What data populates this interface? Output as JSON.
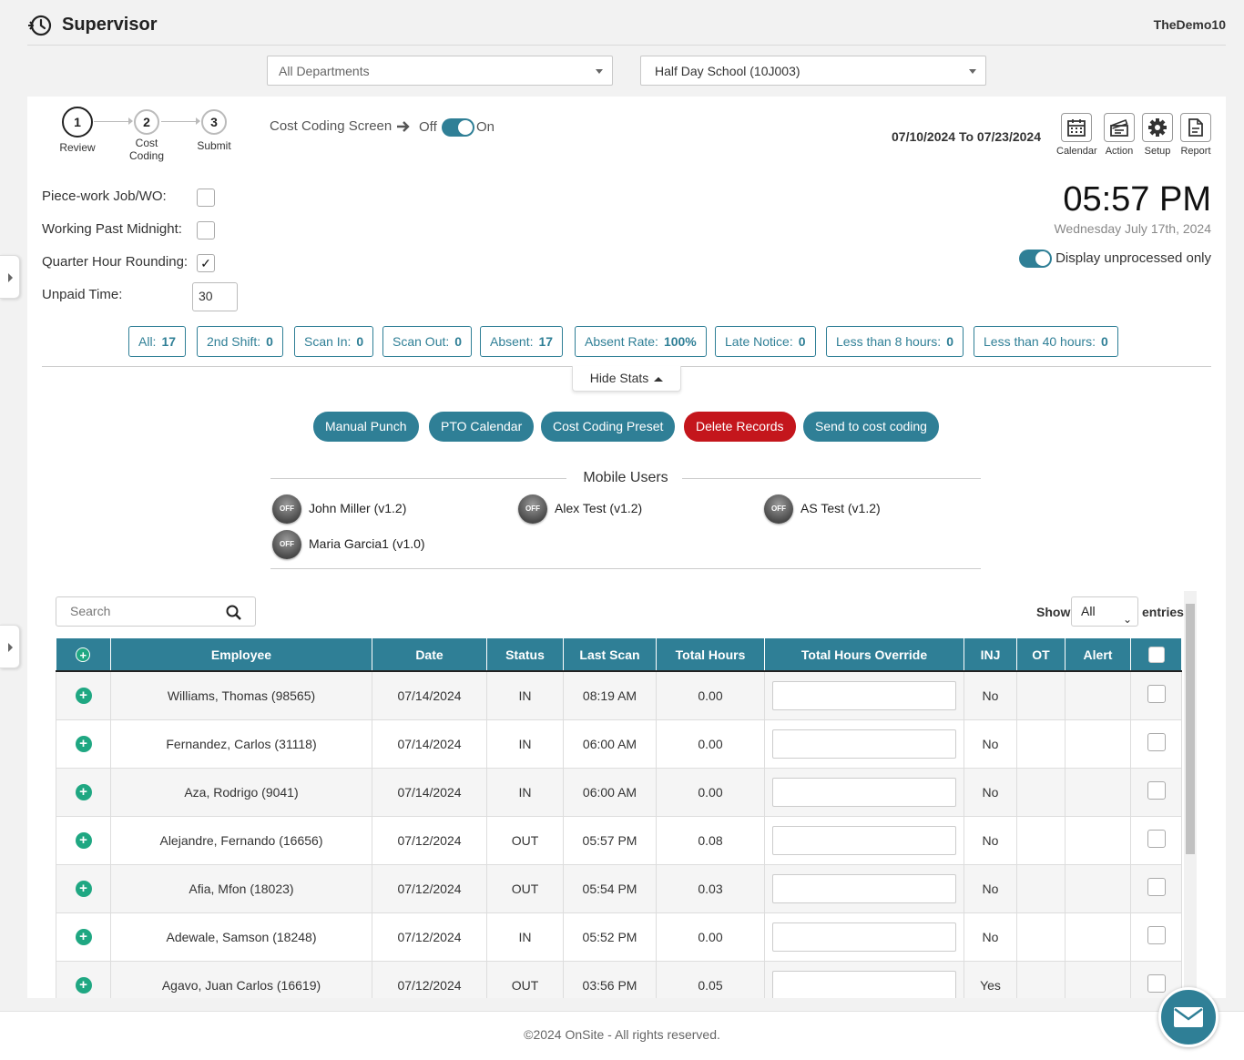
{
  "app": {
    "title": "Supervisor",
    "account": "TheDemo10"
  },
  "filters": {
    "department": "All Departments",
    "school": "Half Day School (10J003)"
  },
  "steps": [
    {
      "num": "1",
      "label": "Review"
    },
    {
      "num": "2",
      "label": "Cost Coding"
    },
    {
      "num": "3",
      "label": "Submit"
    }
  ],
  "cost_coding": {
    "label": "Cost Coding Screen",
    "off": "Off",
    "on": "On"
  },
  "date_range": "07/10/2024 To 07/23/2024",
  "tools": [
    {
      "label": "Calendar",
      "icon": "calendar-icon"
    },
    {
      "label": "Action",
      "icon": "clapperboard-icon"
    },
    {
      "label": "Setup",
      "icon": "gear-icon"
    },
    {
      "label": "Report",
      "icon": "document-icon"
    }
  ],
  "clock": {
    "time": "05:57 PM",
    "date": "Wednesday July 17th, 2024"
  },
  "display_unprocessed": "Display unprocessed only",
  "options": {
    "piecework": "Piece-work Job/WO:",
    "past_midnight": "Working Past Midnight:",
    "quarter_hour": "Quarter Hour Rounding:",
    "quarter_hour_mark": "✓",
    "unpaid": "Unpaid Time:",
    "unpaid_value": "30"
  },
  "stats": [
    {
      "label": "All:",
      "value": "17"
    },
    {
      "label": "2nd Shift:",
      "value": "0"
    },
    {
      "label": "Scan In:",
      "value": "0"
    },
    {
      "label": "Scan Out:",
      "value": "0"
    },
    {
      "label": "Absent:",
      "value": "17"
    },
    {
      "label": "Absent Rate:",
      "value": "100%"
    },
    {
      "label": "Late Notice:",
      "value": "0"
    },
    {
      "label": "Less than 8 hours:",
      "value": "0"
    },
    {
      "label": "Less than 40 hours:",
      "value": "0"
    }
  ],
  "hide_stats": "Hide Stats",
  "actions": {
    "manual_punch": "Manual Punch",
    "pto_calendar": "PTO Calendar",
    "cost_coding_preset": "Cost Coding Preset",
    "delete_records": "Delete Records",
    "send_to_cost_coding": "Send to cost coding"
  },
  "mobile_users": {
    "title": "Mobile Users",
    "badge": "OFF",
    "users": [
      "John Miller (v1.2)",
      "Alex Test (v1.2)",
      "AS Test (v1.2)",
      "Maria Garcia1 (v1.0)"
    ]
  },
  "table": {
    "search_placeholder": "Search",
    "show_label": "Show",
    "show_value": "All",
    "entries_label": "entries",
    "columns": [
      "Employee",
      "Date",
      "Status",
      "Last Scan",
      "Total Hours",
      "Total Hours Override",
      "INJ",
      "OT",
      "Alert"
    ],
    "rows": [
      {
        "employee": "Williams, Thomas (98565)",
        "date": "07/14/2024",
        "status": "IN",
        "last_scan": "08:19 AM",
        "total_hours": "0.00",
        "inj": "No",
        "ot": "",
        "alert": ""
      },
      {
        "employee": "Fernandez, Carlos (31118)",
        "date": "07/14/2024",
        "status": "IN",
        "last_scan": "06:00 AM",
        "total_hours": "0.00",
        "inj": "No",
        "ot": "",
        "alert": ""
      },
      {
        "employee": "Aza, Rodrigo (9041)",
        "date": "07/14/2024",
        "status": "IN",
        "last_scan": "06:00 AM",
        "total_hours": "0.00",
        "inj": "No",
        "ot": "",
        "alert": ""
      },
      {
        "employee": "Alejandre, Fernando (16656)",
        "date": "07/12/2024",
        "status": "OUT",
        "last_scan": "05:57 PM",
        "total_hours": "0.08",
        "inj": "No",
        "ot": "",
        "alert": ""
      },
      {
        "employee": "Afia, Mfon (18023)",
        "date": "07/12/2024",
        "status": "OUT",
        "last_scan": "05:54 PM",
        "total_hours": "0.03",
        "inj": "No",
        "ot": "",
        "alert": ""
      },
      {
        "employee": "Adewale, Samson (18248)",
        "date": "07/12/2024",
        "status": "IN",
        "last_scan": "05:52 PM",
        "total_hours": "0.00",
        "inj": "No",
        "ot": "",
        "alert": ""
      },
      {
        "employee": "Agavo, Juan Carlos (16619)",
        "date": "07/12/2024",
        "status": "OUT",
        "last_scan": "03:56 PM",
        "total_hours": "0.05",
        "inj": "Yes",
        "ot": "",
        "alert": ""
      }
    ]
  },
  "footer": "©2024 OnSite - All rights reserved.",
  "colors": {
    "accent": "#2f7f96",
    "danger": "#c4161c",
    "in_status": "#2a8a2a",
    "plus": "#1fa782"
  }
}
